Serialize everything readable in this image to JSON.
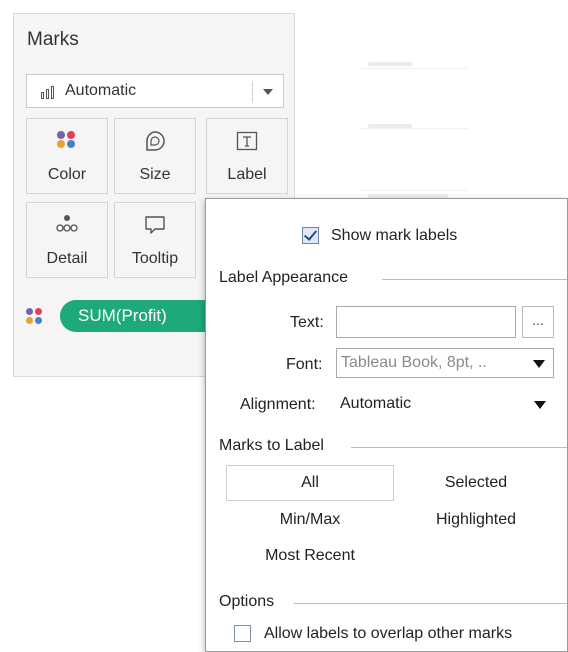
{
  "colors": {
    "pill_green": "#1ea97c",
    "dot_purple": "#7b61a8",
    "dot_red": "#e0405a",
    "dot_orange": "#f0a030",
    "dot_blue": "#4a80c8"
  },
  "marks": {
    "title": "Marks",
    "mark_type": {
      "icon": "bar-chart-icon",
      "value": "Automatic",
      "dropdown_icon": "chevron-down-icon"
    },
    "buttons": [
      {
        "label": "Color",
        "icon": "color-dots-icon"
      },
      {
        "label": "Size",
        "icon": "size-shape-icon"
      },
      {
        "label": "Label",
        "icon": "label-text-icon"
      },
      {
        "label": "Detail",
        "icon": "detail-dots-icon"
      },
      {
        "label": "Tooltip",
        "icon": "tooltip-speech-icon"
      }
    ],
    "field_pill": {
      "icon": "color-dots-icon",
      "label": "SUM(Profit)"
    }
  },
  "label_popup": {
    "show_mark_labels": {
      "label": "Show mark labels",
      "checked": true
    },
    "label_appearance": {
      "header": "Label Appearance",
      "text_label": "Text:",
      "text_value": "",
      "text_button": "...",
      "font_label": "Font:",
      "font_value": "Tableau Book, 8pt, ..",
      "alignment_label": "Alignment:",
      "alignment_value": "Automatic"
    },
    "marks_to_label": {
      "header": "Marks to Label",
      "options": [
        "All",
        "Selected",
        "Min/Max",
        "Highlighted",
        "Most Recent"
      ],
      "selected": "All"
    },
    "options": {
      "header": "Options",
      "allow_overlap": {
        "label": "Allow labels to overlap other marks",
        "checked": false
      }
    }
  }
}
